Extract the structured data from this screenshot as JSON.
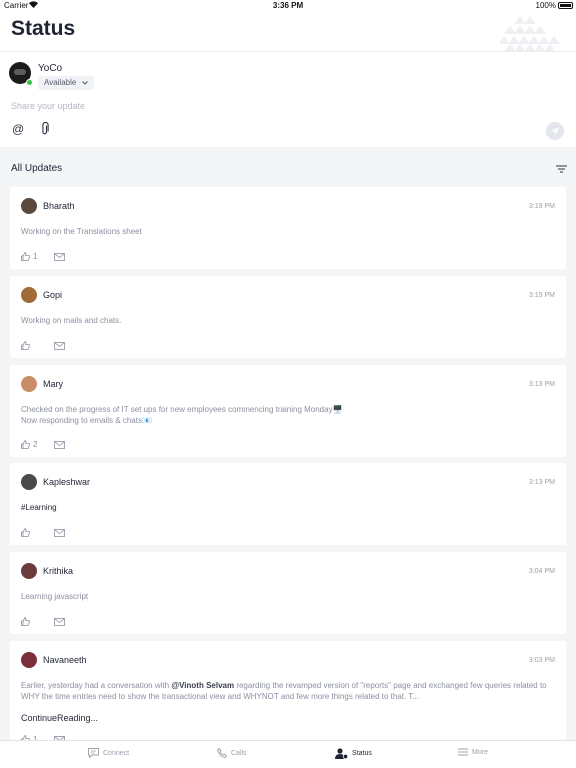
{
  "status_bar": {
    "carrier": "Carrier",
    "time": "3:36 PM",
    "battery": "100%"
  },
  "header": {
    "title": "Status"
  },
  "composer": {
    "user_name": "YoCo",
    "availability": "Available",
    "placeholder": "Share your update",
    "at_symbol": "@"
  },
  "feed": {
    "title": "All Updates",
    "posts": [
      {
        "author": "Bharath",
        "time": "3:19 PM",
        "text": "Working on the Translations sheet",
        "likes": "1",
        "avatar_color": "#5a4a3e"
      },
      {
        "author": "Gopi",
        "time": "3:19 PM",
        "text": "Working on mails and chats.",
        "likes": "",
        "avatar_color": "#a06a3a"
      },
      {
        "author": "Mary",
        "time": "3:13 PM",
        "text": "Checked on the progress of IT set ups for new employees commencing training Monday🖥️",
        "text2": "Now responding to emails & chats📧",
        "likes": "2",
        "avatar_color": "#c98d6a"
      },
      {
        "author": "Kapleshwar",
        "time": "3:13 PM",
        "text": "#Learning",
        "likes": "",
        "avatar_color": "#4a4a4a"
      },
      {
        "author": "Krithika",
        "time": "3:04 PM",
        "text": "Learning javascript",
        "likes": "",
        "avatar_color": "#6b3b3b"
      },
      {
        "author": "Navaneeth",
        "time": "3:03 PM",
        "text_before": "Earlier, yesterday had a conversation with ",
        "mention": "@Vinoth Selvam",
        "text_after": " regarding the revamped version of \"reports\" page and exchanged few queries related to WHY the time entries need to show the transactional view and WHYNOT and few more things related to that. T...",
        "continue": "ContinueReading...",
        "likes": "1",
        "avatar_color": "#7a2f3a"
      }
    ]
  },
  "tabs": [
    {
      "label": "Connect",
      "icon": "chat-icon"
    },
    {
      "label": "Calls",
      "icon": "phone-icon"
    },
    {
      "label": "Status",
      "icon": "status-icon"
    },
    {
      "label": "More",
      "icon": "menu-icon"
    }
  ],
  "colors": {
    "accent": "#1f2433",
    "presence": "#3cc24a",
    "feed_bg": "#f4f5f7"
  }
}
